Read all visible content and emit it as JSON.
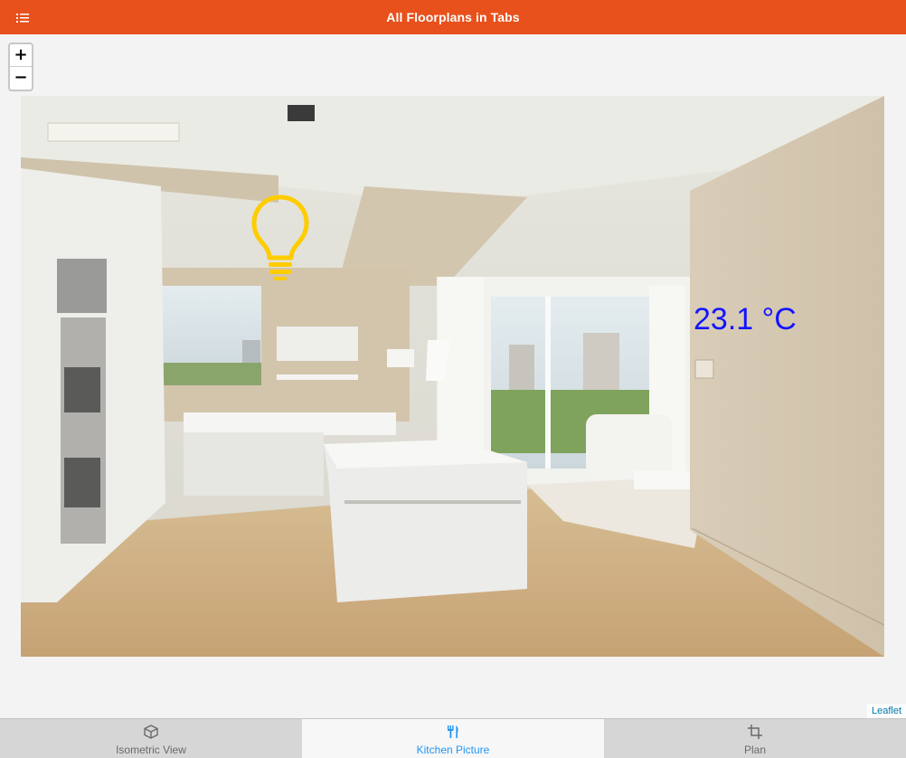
{
  "header": {
    "title": "All Floorplans in Tabs",
    "menu_icon": "list-menu-icon"
  },
  "map": {
    "zoom_in_label": "+",
    "zoom_out_label": "−",
    "temperature": "23.1 °C",
    "light_icon": "lightbulb-icon",
    "attribution": "Leaflet",
    "colors": {
      "temperature": "#1414ff",
      "lightbulb": "#ffcc00"
    }
  },
  "tabs": [
    {
      "label": "Isometric View",
      "icon": "cube-icon",
      "active": false
    },
    {
      "label": "Kitchen Picture",
      "icon": "utensils-icon",
      "active": true
    },
    {
      "label": "Plan",
      "icon": "crop-icon",
      "active": false
    }
  ],
  "colors": {
    "header_bg": "#e8501c",
    "active_tab": "#2196f3"
  }
}
